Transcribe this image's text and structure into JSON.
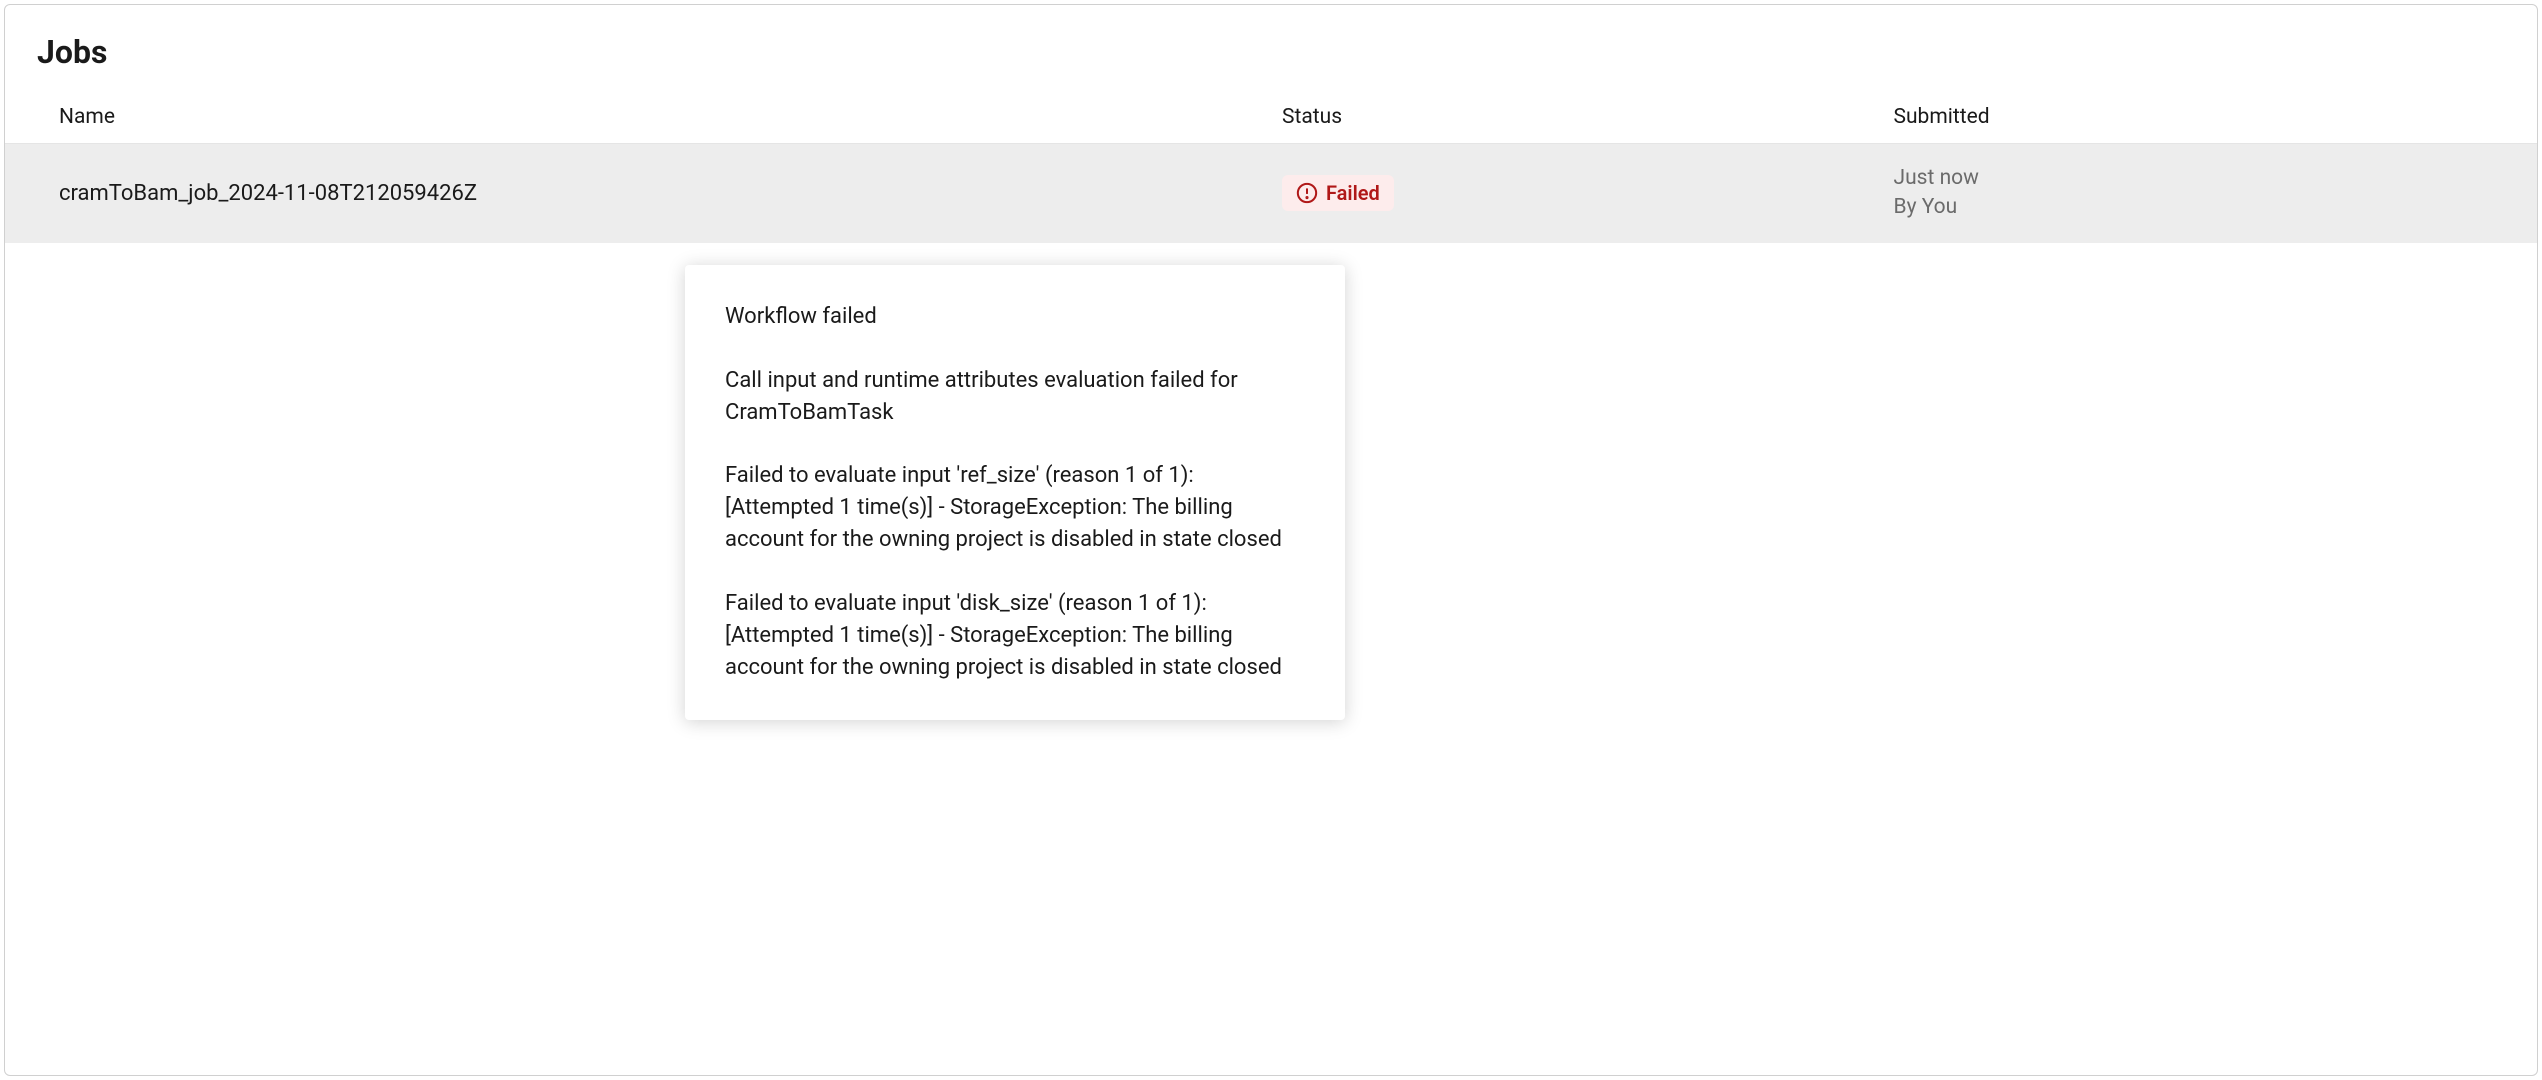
{
  "page": {
    "title": "Jobs"
  },
  "table": {
    "headers": {
      "name": "Name",
      "status": "Status",
      "submitted": "Submitted"
    },
    "rows": [
      {
        "name": "cramToBam_job_2024-11-08T212059426Z",
        "status_label": "Failed",
        "submitted_time": "Just now",
        "submitted_by": "By You"
      }
    ]
  },
  "tooltip": {
    "text": "Workflow failed\n\nCall input and runtime attributes evaluation failed for CramToBamTask\n\nFailed to evaluate input 'ref_size' (reason 1 of 1): [Attempted 1 time(s)] - StorageException: The billing account for the owning project is disabled in state closed\n\nFailed to evaluate input 'disk_size' (reason 1 of 1): [Attempted 1 time(s)] - StorageException: The billing account for the owning project is disabled in state closed"
  },
  "colors": {
    "failed_text": "#b01818",
    "failed_bg": "#fdecec",
    "row_bg": "#ededed",
    "muted": "#6b6b6b"
  }
}
